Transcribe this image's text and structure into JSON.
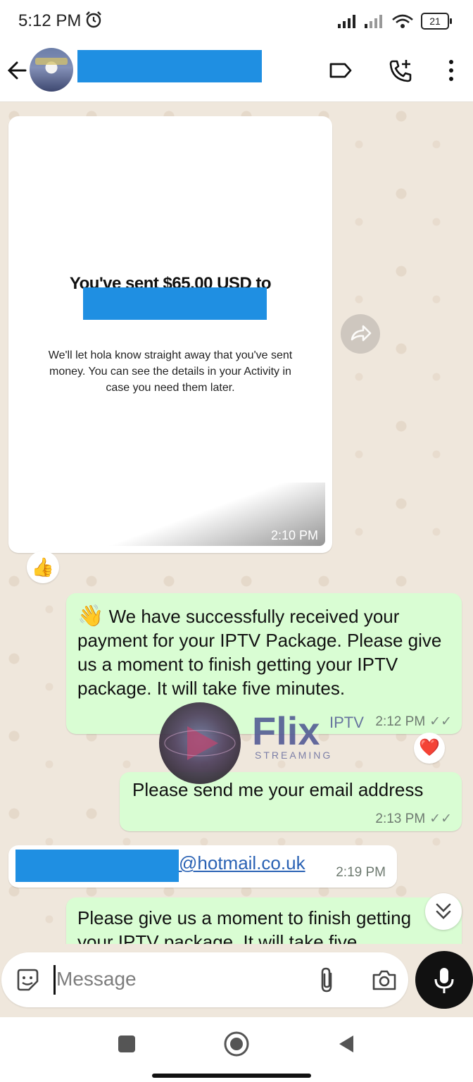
{
  "status_bar": {
    "time": "5:12 PM",
    "battery": "21"
  },
  "header": {
    "contact_name": ""
  },
  "messages": {
    "payment_image": {
      "title": "You've sent $65.00 USD to",
      "body": "We'll let hola know straight away that you've sent money. You can see the details in your Activity in case you need them later.",
      "time": "2:10 PM",
      "reaction": "👍"
    },
    "received_confirmation": {
      "emoji": "👋",
      "text": "We have successfully received your payment for your IPTV Package. Please give us a moment to finish getting your IPTV package. It will take five minutes.",
      "time": "2:12 PM",
      "reaction": "❤️"
    },
    "email_request": {
      "text": "Please send me your email address",
      "time": "2:13 PM"
    },
    "email_reply": {
      "email_domain": "@hotmail.co.uk",
      "time": "2:19 PM"
    },
    "partial_message": {
      "text": "Please give us a moment to finish getting your IPTV package. It will take five"
    }
  },
  "composer": {
    "placeholder": "Message"
  },
  "watermark": {
    "brand": "Flix",
    "sub": "STREAMING",
    "tag": "IPTV"
  },
  "colors": {
    "outgoing_bubble": "#d9fdd3",
    "incoming_bubble": "#ffffff",
    "redaction": "#1f8fe2",
    "chat_bg": "#efe7dc"
  }
}
